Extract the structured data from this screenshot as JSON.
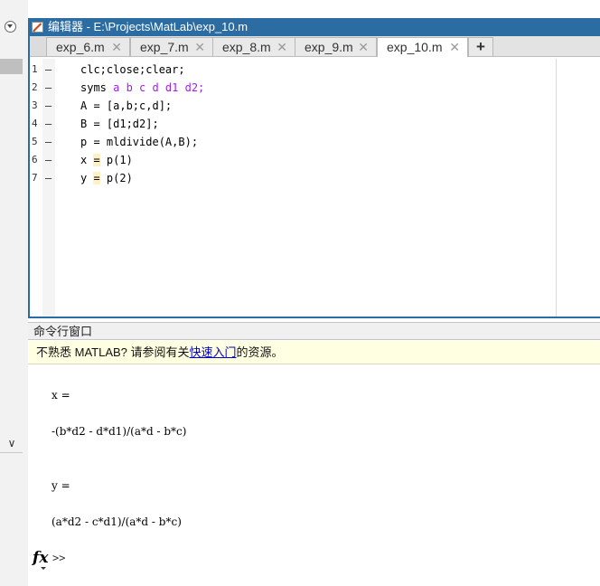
{
  "editor": {
    "title": "编辑器 - E:\\Projects\\MatLab\\exp_10.m",
    "tabs": [
      {
        "label": "exp_6.m",
        "active": false
      },
      {
        "label": "exp_7.m",
        "active": false
      },
      {
        "label": "exp_8.m",
        "active": false
      },
      {
        "label": "exp_9.m",
        "active": false
      },
      {
        "label": "exp_10.m",
        "active": true
      }
    ],
    "close_glyph": "✕",
    "add_tab": "+",
    "line_marker": "–",
    "lines": [
      {
        "num": "1",
        "code": "clc;close;clear;"
      },
      {
        "num": "2",
        "pre": "syms ",
        "str": "a b c d d1 d2;"
      },
      {
        "num": "3",
        "code": "A = [a,b;c,d];"
      },
      {
        "num": "4",
        "code": "B = [d1;d2];"
      },
      {
        "num": "5",
        "code": "p = mldivide(A,B);"
      },
      {
        "num": "6",
        "pre": "x ",
        "hl": "=",
        "post": " p(1)"
      },
      {
        "num": "7",
        "pre": "y ",
        "hl": "=",
        "post": " p(2)"
      }
    ]
  },
  "command_window": {
    "header": "命令行窗口",
    "notice_prefix": "不熟悉 MATLAB? 请参阅有关",
    "notice_link": "快速入门",
    "notice_suffix": "的资源。",
    "outputs": [
      "x =",
      "-(b*d2 - d*d1)/(a*d - b*c)",
      "y =",
      "(a*d2 - c*d1)/(a*d - b*c)"
    ],
    "fx_label": "fx",
    "prompt": ">>"
  },
  "icons": {
    "editor_icon": "editor-pencil-icon",
    "options_icon": "options-dropdown-icon",
    "collapse_icon": "chevron-down-icon"
  },
  "colors": {
    "title_bar": "#2b6ca3",
    "string": "#a020f0",
    "link": "#0000cc",
    "notice_bg": "#ffffe1"
  }
}
